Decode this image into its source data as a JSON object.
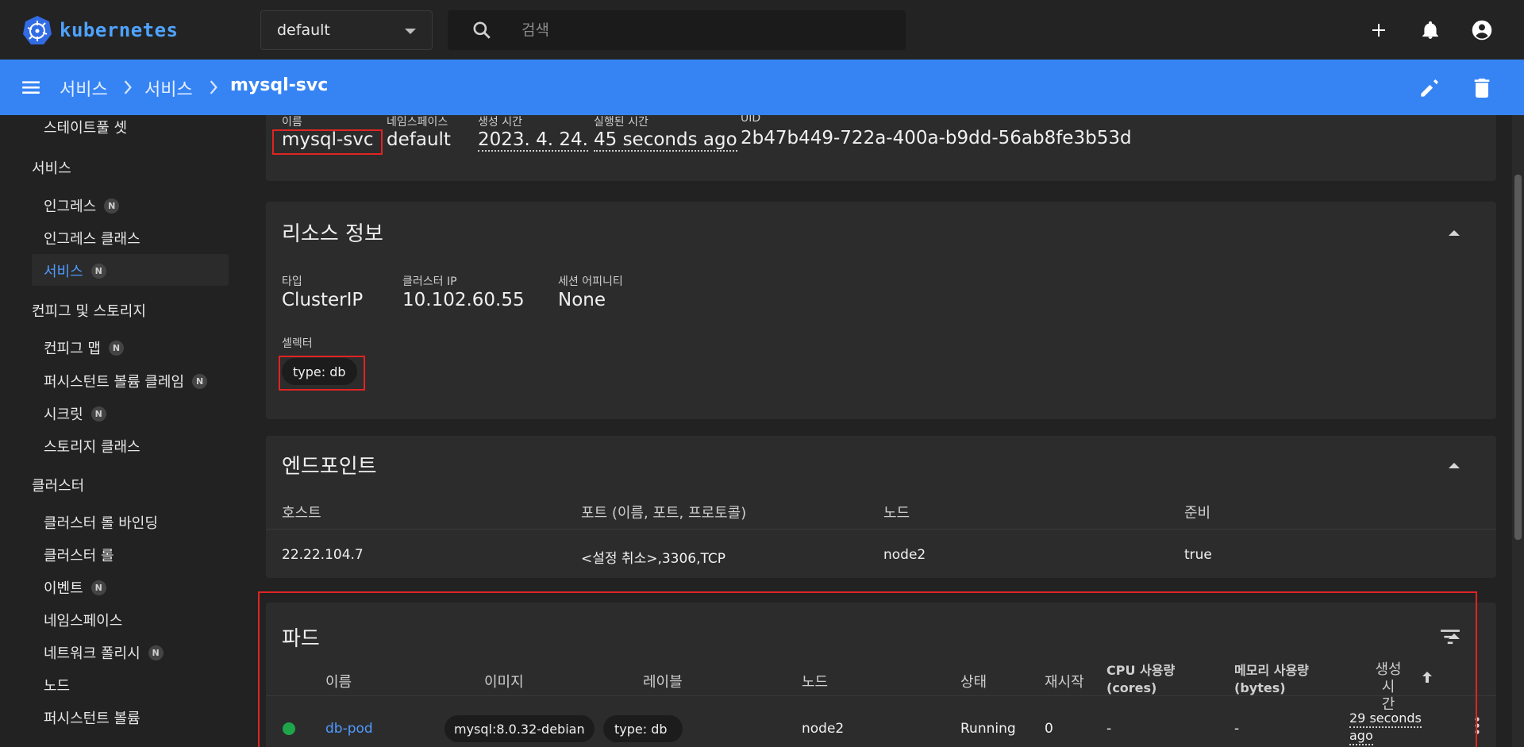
{
  "topbar": {
    "brand": "kubernetes",
    "namespace": "default",
    "search_placeholder": "검색"
  },
  "breadcrumb": {
    "items": [
      "서비스",
      "서비스",
      "mysql-svc"
    ]
  },
  "sidebar": {
    "items": [
      {
        "label": "스테이트풀 셋",
        "badge": ""
      },
      {
        "label": "서비스",
        "group": true
      },
      {
        "label": "인그레스",
        "badge": "N"
      },
      {
        "label": "인그레스 클래스",
        "badge": ""
      },
      {
        "label": "서비스",
        "badge": "N",
        "active": true
      },
      {
        "label": "컨피그 및 스토리지",
        "group": true
      },
      {
        "label": "컨피그 맵",
        "badge": "N"
      },
      {
        "label": "퍼시스턴트 볼륨 클레임",
        "badge": "N"
      },
      {
        "label": "시크릿",
        "badge": "N"
      },
      {
        "label": "스토리지 클래스",
        "badge": ""
      },
      {
        "label": "클러스터",
        "group": true
      },
      {
        "label": "클러스터 롤 바인딩",
        "badge": ""
      },
      {
        "label": "클러스터 롤",
        "badge": ""
      },
      {
        "label": "이벤트",
        "badge": "N"
      },
      {
        "label": "네임스페이스",
        "badge": ""
      },
      {
        "label": "네트워크 폴리시",
        "badge": "N"
      },
      {
        "label": "노드",
        "badge": ""
      },
      {
        "label": "퍼시스턴트 볼륨",
        "badge": ""
      }
    ]
  },
  "metadata": {
    "name_label": "이름",
    "name": "mysql-svc",
    "namespace_label": "네임스페이스",
    "namespace": "default",
    "created_label": "생성 시간",
    "created": "2023. 4. 24.",
    "age_label": "실행된 시간",
    "age": "45 seconds ago",
    "uid_label": "UID",
    "uid": "2b47b449-722a-400a-b9dd-56ab8fe3b53d"
  },
  "resource_info": {
    "title": "리소스 정보",
    "type_label": "타입",
    "type": "ClusterIP",
    "cluster_ip_label": "클러스터 IP",
    "cluster_ip": "10.102.60.55",
    "session_label": "세션 어피니티",
    "session": "None",
    "selector_label": "셀렉터",
    "selector": "type: db"
  },
  "endpoints": {
    "title": "엔드포인트",
    "headers": [
      "호스트",
      "포트 (이름, 포트, 프로토콜)",
      "노드",
      "준비"
    ],
    "row": [
      "22.22.104.7",
      "<설정 취소>,3306,TCP",
      "node2",
      "true"
    ]
  },
  "pods": {
    "title": "파드",
    "headers": {
      "name": "이름",
      "image": "이미지",
      "labels": "레이블",
      "node": "노드",
      "status": "상태",
      "restarts": "재시작",
      "cpu_1": "CPU 사용량",
      "cpu_2": "(cores)",
      "mem_1": "메모리 사용량",
      "mem_2": "(bytes)",
      "created_1": "생성 시",
      "created_2": "간"
    },
    "row": {
      "name": "db-pod",
      "image": "mysql:8.0.32-debian",
      "label": "type: db",
      "node": "node2",
      "status": "Running",
      "restarts": "0",
      "cpu": "-",
      "mem": "-",
      "created_1": "29 seconds",
      "created_2": "ago"
    }
  },
  "colors": {
    "accent": "#3684f4",
    "link": "#4f9bff",
    "running": "#1fa64a",
    "highlight": "#e02424"
  }
}
